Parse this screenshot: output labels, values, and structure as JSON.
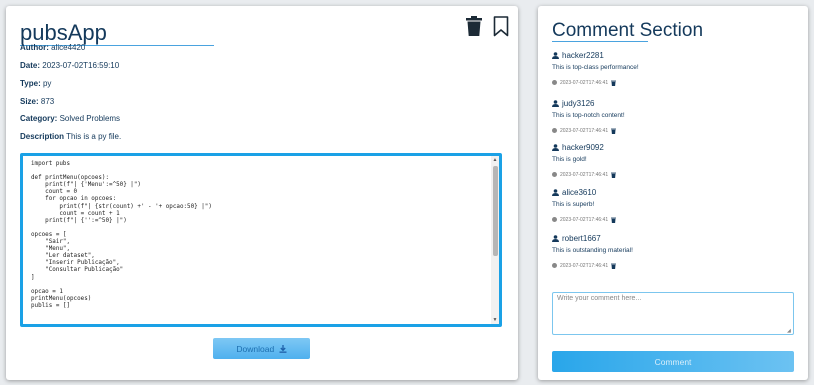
{
  "file": {
    "title": "pubsApp",
    "author_label": "Author:",
    "author": "alice4420",
    "date_label": "Date:",
    "date": "2023-07-02T16:59:10",
    "type_label": "Type:",
    "type": "py",
    "size_label": "Size:",
    "size": "873",
    "category_label": "Category:",
    "category": "Solved Problems",
    "description_label": "Description",
    "description": "This is a py file.",
    "code": "import pubs\n\ndef printMenu(opcoes):\n    print(f\"| {'Menu':=^50} |\")\n    count = 0\n    for opcao in opcoes:\n        print(f\"| {str(count) +' - '+ opcao:50} |\")\n        count = count + 1\n    print(f\"| {'':=^50} |\")\n\nopcoes = [\n    \"Sair\",\n    \"Menu\",\n    \"Ler dataset\",\n    \"Inserir Publicação\",\n    \"Consultar Publicação\"\n]\n\nopcao = 1\nprintMenu(opcoes)\npublis = []",
    "download_label": "Download",
    "icons": {
      "delete": "trash-icon",
      "bookmark": "bookmark-icon",
      "download": "download-icon"
    }
  },
  "comments_section": {
    "title": "Comment Section",
    "comments": [
      {
        "user": "hacker2281",
        "text": "This is top-class performance!",
        "timestamp": "2023-07-02T17:46:41"
      },
      {
        "user": "judy3126",
        "text": "This is top-notch content!",
        "timestamp": "2023-07-02T17:46:41"
      },
      {
        "user": "hacker9092",
        "text": "This is gold!",
        "timestamp": "2023-07-02T17:46:41"
      },
      {
        "user": "alice3610",
        "text": "This is superb!",
        "timestamp": "2023-07-02T17:46:41"
      },
      {
        "user": "robert1667",
        "text": "This is outstanding material!",
        "timestamp": "2023-07-02T17:46:41"
      }
    ],
    "input_placeholder": "Write your comment here...",
    "input_value": "",
    "submit_label": "Comment"
  },
  "colors": {
    "accent": "#1aa1e6",
    "title": "#14395b",
    "button": "#4fb0ee"
  }
}
